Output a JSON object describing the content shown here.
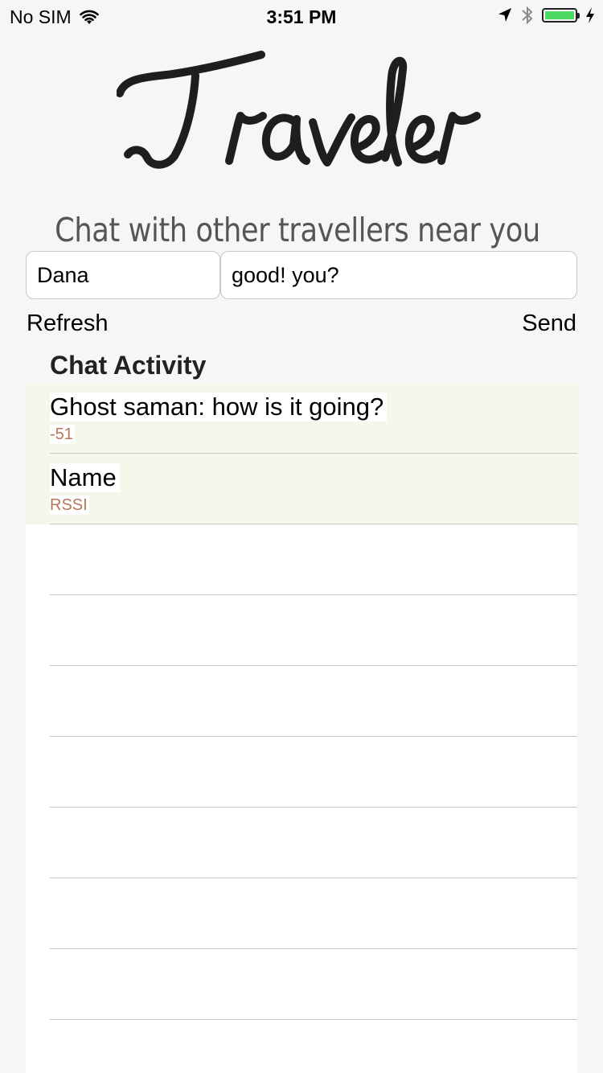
{
  "status_bar": {
    "carrier": "No SIM",
    "time": "3:51 PM",
    "icons": [
      "wifi-icon",
      "location-arrow-icon",
      "bluetooth-icon",
      "battery-icon",
      "charging-bolt-icon"
    ],
    "battery_color": "#4cd964"
  },
  "app": {
    "logo_text": "Traveler",
    "subtitle": "Chat with other travellers near you"
  },
  "form": {
    "name_value": "Dana",
    "message_value": "good! you?",
    "refresh_label": "Refresh",
    "send_label": "Send"
  },
  "chat": {
    "section_title": "Chat Activity",
    "rows": [
      {
        "title": "Ghost saman: how is it going?",
        "subtitle": "-51"
      },
      {
        "title": "Name",
        "subtitle": "RSSI"
      }
    ],
    "subtitle_color": "#b5765b",
    "row_highlight_color": "#f5f7ea"
  }
}
